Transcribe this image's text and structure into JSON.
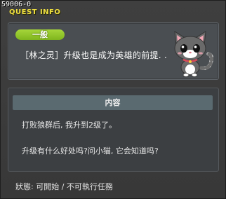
{
  "window": {
    "quest_id": "59006-0",
    "title": "QUEST INFO"
  },
  "quest": {
    "category_badge": "一般",
    "name": "［林之灵］升级也是成为英雄的前提. .",
    "npc_icon": "gray-cat-npc-icon"
  },
  "content": {
    "header": "内容",
    "lines": [
      "打败狼群后, 我升到2级了。",
      "升级有什么好处吗?问小猫, 它会知道吗?"
    ]
  },
  "status": {
    "text": "狀態:  可開始  /  不可執行任務"
  },
  "colors": {
    "title": "#f0e040",
    "badge": "#8cc42a",
    "panel": "#4a4e52",
    "content_header": "#5a6a70"
  }
}
